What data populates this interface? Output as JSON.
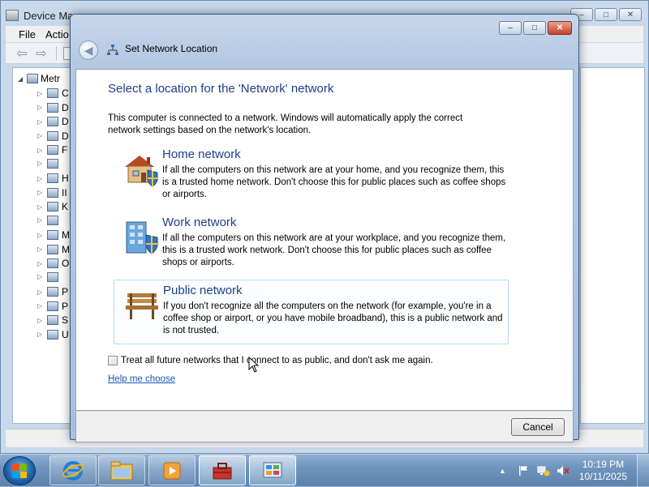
{
  "device_manager": {
    "title": "Device Ma",
    "menu": [
      "File",
      "Actio"
    ],
    "tree_root_label": "Metr",
    "tree_items": [
      "C",
      "D",
      "D",
      "D",
      "F",
      "",
      "H",
      "II",
      "K",
      "",
      "M",
      "M",
      "O",
      "",
      "P",
      "P",
      "S",
      "U"
    ]
  },
  "dialog": {
    "title": "Set Network Location",
    "heading": "Select a location for the 'Network' network",
    "intro": "This computer is connected to a network. Windows will automatically apply the correct network settings based on the network's location.",
    "options": [
      {
        "title": "Home network",
        "description": "If all the computers on this network are at your home, and you recognize them, this is a trusted home network.  Don't choose this for public places such as coffee shops or airports.",
        "icon": "home-network-icon"
      },
      {
        "title": "Work network",
        "description": "If all the computers on this network are at your workplace, and you recognize them, this is a trusted work network.  Don't choose this for public places such as coffee shops or airports.",
        "icon": "work-network-icon"
      },
      {
        "title": "Public network",
        "description": "If you don't recognize all the computers on the network (for example, you're in a coffee shop or airport, or you have mobile broadband), this is a public network and is not trusted.",
        "icon": "public-network-icon"
      }
    ],
    "checkbox_label": "Treat all future networks that I connect to as public, and don't ask me again.",
    "checkbox_checked": false,
    "help_link": "Help me choose",
    "cancel_label": "Cancel"
  },
  "taskbar": {
    "apps": [
      "internet-explorer-icon",
      "windows-explorer-icon",
      "media-player-icon",
      "toolbox-icon",
      "control-panel-icon"
    ],
    "clock_time": "10:19 PM",
    "clock_date": "10/11/2025"
  },
  "colors": {
    "heading": "#1e3f8a",
    "link": "#1a56b8",
    "taskbar": "#6f94bd"
  }
}
